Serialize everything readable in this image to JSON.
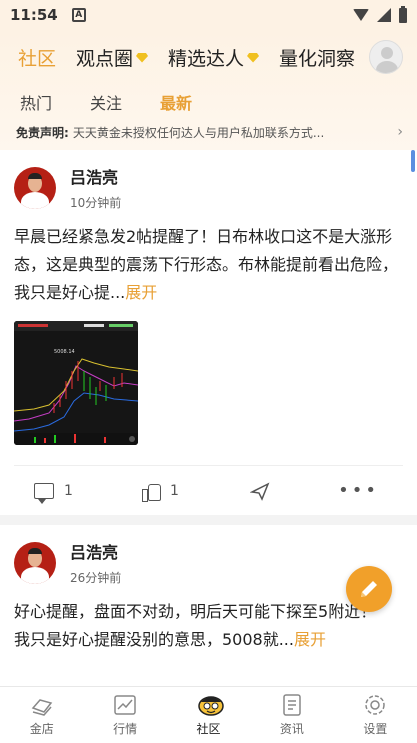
{
  "status": {
    "time": "11:54",
    "notif_glyph": "A"
  },
  "topnav": {
    "items": [
      {
        "label": "社区",
        "active": true
      },
      {
        "label": "观点圈",
        "badge": "diamond-icon"
      },
      {
        "label": "精选达人",
        "badge": "diamond-icon"
      },
      {
        "label": "量化洞察"
      }
    ]
  },
  "subtabs": [
    {
      "label": "热门"
    },
    {
      "label": "关注"
    },
    {
      "label": "最新",
      "active": true
    }
  ],
  "disclaimer": {
    "label": "免责声明:",
    "text": "天天黄金未授权任何达人与用户私加联系方式..."
  },
  "posts": [
    {
      "author": "吕浩亮",
      "time": "10分钟前",
      "text": "早晨已经紧急发2帖提醒了！日布林收口这不是大涨形态，这是典型的震荡下行形态。布林能提前看出危险，我只是好心提...",
      "expand": "展开",
      "comments": "1",
      "likes": "1"
    },
    {
      "author": "吕浩亮",
      "time": "26分钟前",
      "text": "好心提醒，盘面不对劲，明后天可能下探至5",
      "text_tail": "附近！",
      "text2": "我只是好心提醒没别的意思，5008就...",
      "expand": "展开"
    }
  ],
  "chart_thumb": {
    "label": "5008.14"
  },
  "bottombar": [
    {
      "label": "金店"
    },
    {
      "label": "行情"
    },
    {
      "label": "社区",
      "active": true
    },
    {
      "label": "资讯"
    },
    {
      "label": "设置"
    }
  ],
  "colors": {
    "accent": "#e8a035",
    "header_bg": "#fdf2e4",
    "fab": "#f1a02a"
  }
}
